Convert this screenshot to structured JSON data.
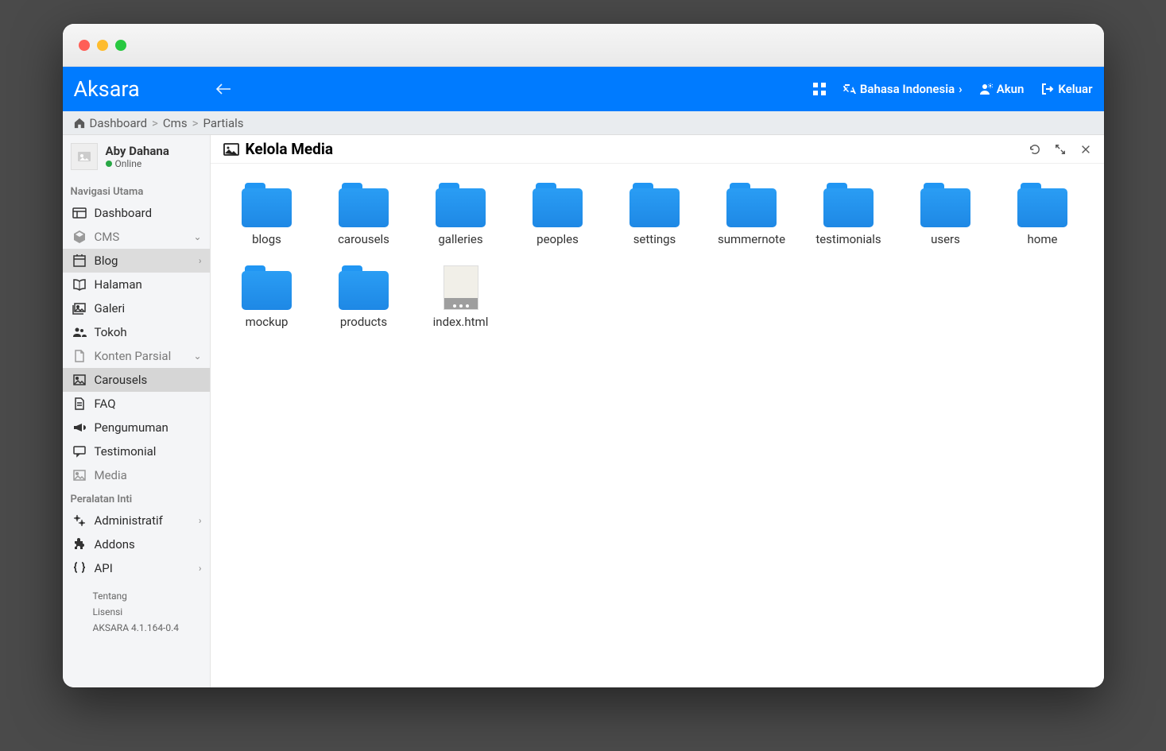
{
  "brand": "Aksara",
  "topbar": {
    "language": "Bahasa Indonesia",
    "account": "Akun",
    "logout": "Keluar"
  },
  "breadcrumb": [
    "Dashboard",
    "Cms",
    "Partials"
  ],
  "user": {
    "name": "Aby Dahana",
    "status": "Online"
  },
  "navHeader1": "Navigasi Utama",
  "navHeader2": "Peralatan Inti",
  "nav": {
    "dashboard": "Dashboard",
    "cms": "CMS",
    "blog": "Blog",
    "halaman": "Halaman",
    "galeri": "Galeri",
    "tokoh": "Tokoh",
    "kontenParsial": "Konten Parsial",
    "carousels": "Carousels",
    "faq": "FAQ",
    "pengumuman": "Pengumuman",
    "testimonial": "Testimonial",
    "media": "Media",
    "administratif": "Administratif",
    "addons": "Addons",
    "api": "API"
  },
  "footer": {
    "tentang": "Tentang",
    "lisensi": "Lisensi",
    "version": "AKSARA 4.1.164-0.4"
  },
  "main": {
    "title": "Kelola Media"
  },
  "items": [
    {
      "name": "blogs",
      "type": "folder"
    },
    {
      "name": "carousels",
      "type": "folder"
    },
    {
      "name": "galleries",
      "type": "folder"
    },
    {
      "name": "peoples",
      "type": "folder"
    },
    {
      "name": "settings",
      "type": "folder"
    },
    {
      "name": "summernote",
      "type": "folder"
    },
    {
      "name": "testimonials",
      "type": "folder"
    },
    {
      "name": "users",
      "type": "folder"
    },
    {
      "name": "home",
      "type": "folder"
    },
    {
      "name": "mockup",
      "type": "folder"
    },
    {
      "name": "products",
      "type": "folder"
    },
    {
      "name": "index.html",
      "type": "file"
    }
  ]
}
